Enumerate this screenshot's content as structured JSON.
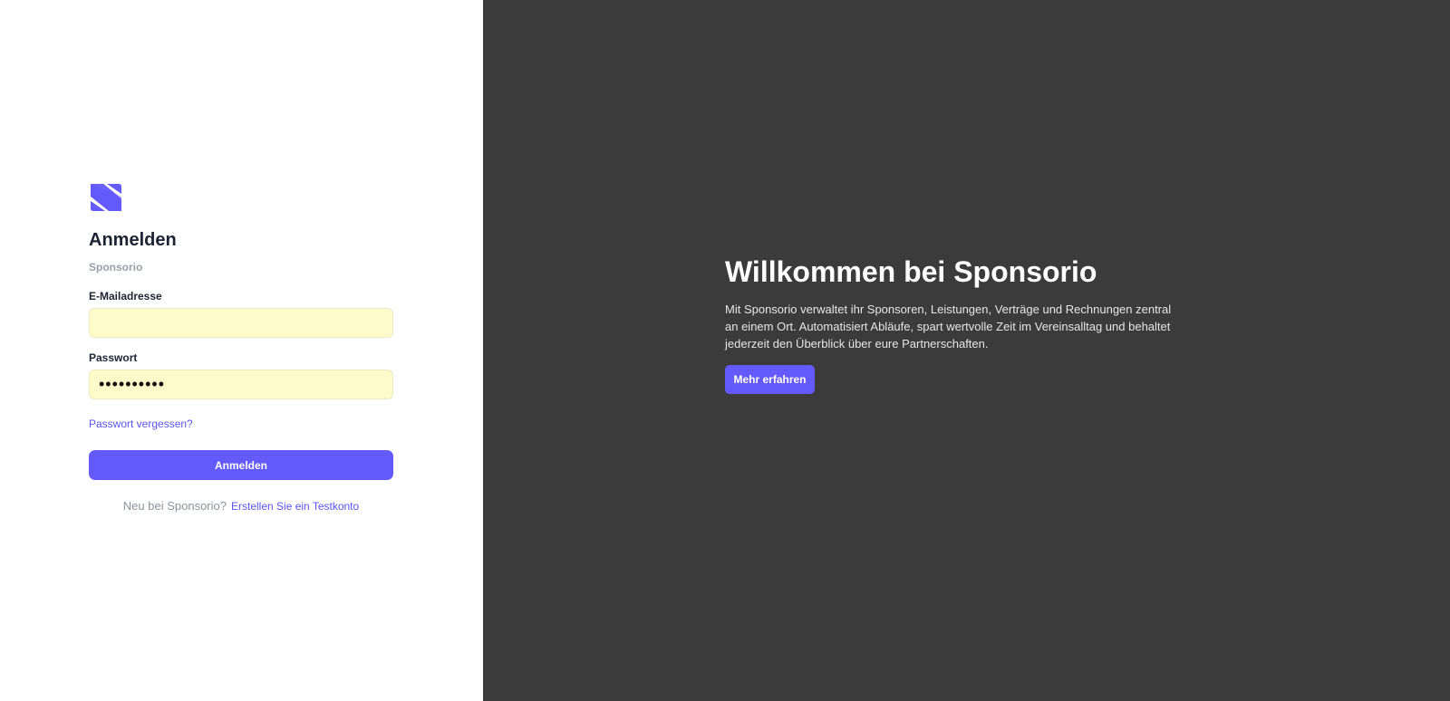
{
  "colors": {
    "accent": "#6459fb",
    "left_bg": "#ffffff",
    "right_bg": "#3b3b3b",
    "input_bg": "#fefac9"
  },
  "login": {
    "logo_icon": "sponsorio-s-logo-icon",
    "title": "Anmelden",
    "subtitle": "Sponsorio",
    "email_label": "E-Mailadresse",
    "email_value": "",
    "password_label": "Passwort",
    "password_value": "••••••••••",
    "forgot_link": "Passwort vergessen?",
    "submit_label": "Anmelden",
    "signup_prompt": "Neu bei Sponsorio?",
    "signup_link": "Erstellen Sie ein Testkonto"
  },
  "hero": {
    "title": "Willkommen bei Sponsorio",
    "text": "Mit Sponsorio verwaltet ihr Sponsoren, Leistungen, Verträge und Rechnungen zentral an einem Ort. Automatisiert Abläufe, spart wertvolle Zeit im Vereinsalltag und behaltet jederzeit den Überblick über eure Partnerschaften.",
    "button_label": "Mehr erfahren"
  }
}
